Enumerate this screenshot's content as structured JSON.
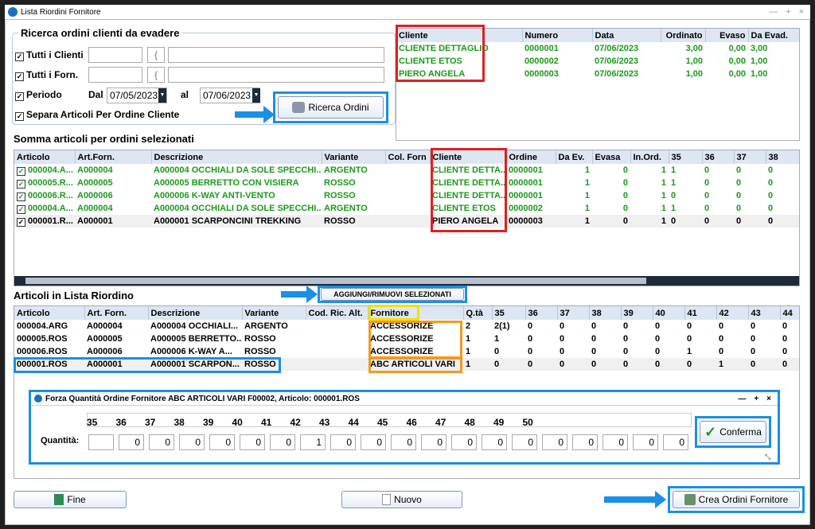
{
  "window": {
    "title": "Lista Riordini Fornitore",
    "controls": [
      "—",
      "+",
      "×"
    ]
  },
  "search": {
    "group_title": "Ricerca ordini clienti da evadere",
    "tutti_clienti": "Tutti i Clienti",
    "tutti_forn": "Tutti i Forn.",
    "periodo": "Periodo",
    "dal": "Dal",
    "dal_value": "07/05/2023",
    "al": "al",
    "al_value": "07/06/2023",
    "separa": "Separa Articoli Per Ordine Cliente",
    "ricerca_button": "Ricerca Ordini",
    "lookup": "{"
  },
  "orders": {
    "headers": [
      "Cliente",
      "Numero",
      "Data",
      "Ordinato",
      "Evaso",
      "Da Evad."
    ],
    "rows": [
      [
        "CLIENTE DETTAGLIO",
        "0000001",
        "07/06/2023",
        "3,00",
        "0,00",
        "3,00"
      ],
      [
        "CLIENTE ETOS",
        "0000002",
        "07/06/2023",
        "1,00",
        "0,00",
        "1,00"
      ],
      [
        "PIERO ANGELA",
        "0000003",
        "07/06/2023",
        "1,00",
        "0,00",
        "1,00"
      ]
    ]
  },
  "somma": {
    "title": "Somma articoli per ordini selezionati",
    "headers": [
      "Articolo",
      "Art.Forn.",
      "Descrizione",
      "Variante",
      "Col. Forn",
      "Cliente",
      "Ordine",
      "Da Ev.",
      "Evasa",
      "In.Ord.",
      "35",
      "36",
      "37",
      "38"
    ],
    "rows": [
      [
        "000004.A...",
        "A000004",
        "A000004 OCCHIALI DA SOLE SPECCHI...",
        "ARGENTO",
        "",
        "CLIENTE DETTA...",
        "0000001",
        "1",
        "0",
        "1",
        "1",
        "0",
        "0",
        "0"
      ],
      [
        "000005.R...",
        "A000005",
        "A000005 BERRETTO CON VISIERA",
        "ROSSO",
        "",
        "CLIENTE DETTA...",
        "0000001",
        "1",
        "0",
        "1",
        "1",
        "0",
        "0",
        "0"
      ],
      [
        "000006.R...",
        "A000006",
        "A000006 K-WAY ANTI-VENTO",
        "ROSSO",
        "",
        "CLIENTE DETTA...",
        "0000001",
        "1",
        "0",
        "1",
        "0",
        "0",
        "0",
        "0"
      ],
      [
        "000004.A...",
        "A000004",
        "A000004 OCCHIALI DA SOLE SPECCHI...",
        "ARGENTO",
        "",
        "CLIENTE ETOS",
        "0000002",
        "1",
        "0",
        "1",
        "1",
        "0",
        "0",
        "0"
      ],
      [
        "000001.R...",
        "A000001",
        "A000001 SCARPONCINI TREKKING",
        "ROSSO",
        "",
        "PIERO ANGELA",
        "0000003",
        "1",
        "0",
        "1",
        "0",
        "0",
        "0",
        "0"
      ]
    ]
  },
  "lista": {
    "title": "Articoli in Lista Riordino",
    "aggiungi_button": "AGGIUNGI/RIMUOVI SELEZIONATI",
    "headers": [
      "Articolo",
      "Art. Forn.",
      "Descrizione",
      "Variante",
      "Cod. Ric. Alt.",
      "Fornitore",
      "Q.tà",
      "35",
      "36",
      "37",
      "38",
      "39",
      "40",
      "41",
      "42",
      "43",
      "44"
    ],
    "rows": [
      [
        "000004.ARG",
        "A000004",
        "A000004 OCCHIALI...",
        "ARGENTO",
        "",
        "ACCESSORIZE",
        "2",
        "2(1)",
        "0",
        "0",
        "0",
        "0",
        "0",
        "0",
        "0",
        "0",
        "0"
      ],
      [
        "000005.ROS",
        "A000005",
        "A000005 BERRETTO...",
        "ROSSO",
        "",
        "ACCESSORIZE",
        "1",
        "1",
        "0",
        "0",
        "0",
        "0",
        "0",
        "0",
        "0",
        "0",
        "0"
      ],
      [
        "000006.ROS",
        "A000006",
        "A000006 K-WAY A...",
        "ROSSO",
        "",
        "ACCESSORIZE",
        "1",
        "0",
        "0",
        "0",
        "0",
        "0",
        "0",
        "1",
        "0",
        "0",
        "0"
      ],
      [
        "000001.ROS",
        "A000001",
        "A000001 SCARPON...",
        "ROSSO",
        "",
        "ABC ARTICOLI VARI",
        "1",
        "0",
        "0",
        "0",
        "0",
        "0",
        "0",
        "0",
        "1",
        "0",
        "0"
      ]
    ]
  },
  "dialog": {
    "title": "Forza Quantità Ordine Fornitore ABC ARTICOLI VARI  F00002, Articolo: 000001.ROS",
    "sizes": [
      "35",
      "36",
      "37",
      "38",
      "39",
      "40",
      "41",
      "42",
      "43",
      "44",
      "45",
      "46",
      "47",
      "48",
      "49",
      "50"
    ],
    "quantita_label": "Quantità:",
    "quantities": [
      "",
      "0",
      "0",
      "0",
      "0",
      "0",
      "0",
      "1",
      "0",
      "0",
      "0",
      "0",
      "0",
      "0",
      "0",
      "0",
      "0",
      "0",
      "0",
      "0"
    ],
    "conferma": "Conferma"
  },
  "footer": {
    "fine": "Fine",
    "nuovo": "Nuovo",
    "crea": "Crea Ordini Fornitore"
  }
}
